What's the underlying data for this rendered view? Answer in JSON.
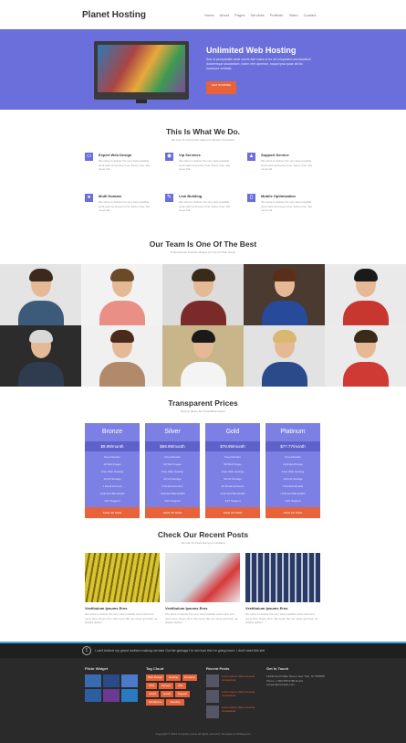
{
  "header": {
    "logo": "Planet Hosting",
    "nav": [
      "Home",
      "About",
      "Pages",
      "Services",
      "Portfolio",
      "Video",
      "Contact"
    ]
  },
  "hero": {
    "title": "Unlimited Web Hosting",
    "description": "Sed ut perspiciatis unde omnis iste natus error sit voluptatem accusantium doloremque laudantium, totam rem aperiam, eaque ipsa quae ab illo inventore veritatis.",
    "button": "GET STARTED"
  },
  "services": {
    "title": "This Is What We Do.",
    "subtitle": "We Like To Invent New Ideas For Modern Templates",
    "items": [
      {
        "title": "Expert Web Design",
        "icon": "monitor-icon",
        "desc": "We strive to deliver the very best possible work each and every time. Every time. We never fail."
      },
      {
        "title": "Vip Services",
        "icon": "car-icon",
        "desc": "We strive to deliver the very best possible work each and every time. Every time. We never fail."
      },
      {
        "title": "Support Service",
        "icon": "chart-icon",
        "desc": "We strive to deliver the very best possible work each and every time. Every time. We never fail."
      },
      {
        "title": "Multi Domain",
        "icon": "globe-icon",
        "desc": "We strive to deliver the very best possible work each and every time. Every time. We never fail."
      },
      {
        "title": "Link Building",
        "icon": "pencil-icon",
        "desc": "We strive to deliver the very best possible work each and every time. Every time. We never fail."
      },
      {
        "title": "Mobile Optimization",
        "icon": "tablet-icon",
        "desc": "We strive to deliver the very best possible work each and every time. Every time. We never fail."
      }
    ]
  },
  "team": {
    "title": "Our Team Is One Of The Best",
    "subtitle": "Professionals That Are Always On Top Of Their Game"
  },
  "pricing": {
    "title": "Transparent Prices",
    "subtitle": "Pricing Tables For Small Businesses",
    "plans": [
      {
        "name": "Bronze",
        "price": "$9.99/month",
        "features": [
          "Free Domain",
          "10 Web Pages",
          "Free Web Hosting",
          "10 Gb Storage",
          "1 Email Account",
          "Unlimited Bandwidth",
          "24/7 Support"
        ],
        "button": "SIGN UP NOW"
      },
      {
        "name": "Silver",
        "price": "$69.99/month",
        "features": [
          "Free Domain",
          "20 Web Pages",
          "Free Web Hosting",
          "20 Gb Storage",
          "5 Email Accounts",
          "Unlimited Bandwidth",
          "24/7 Support"
        ],
        "button": "SIGN UP NOW"
      },
      {
        "name": "Gold",
        "price": "$79.99/month",
        "features": [
          "Free Domain",
          "50 Web Pages",
          "Free Web Hosting",
          "50 Gb Storage",
          "10 Email Accounts",
          "Unlimited Bandwidth",
          "24/7 Support"
        ],
        "button": "SIGN UP NOW"
      },
      {
        "name": "Platinum",
        "price": "$77.77/month",
        "features": [
          "Free Domain",
          "Unlimited Pages",
          "Free Web Hosting",
          "100 Gb Storage",
          "Unlimited Emails",
          "Unlimited Bandwidth",
          "24/7 Support"
        ],
        "button": "SIGN UP NOW"
      }
    ]
  },
  "posts": {
    "title": "Check Our Recent Posts",
    "subtitle": "We Like To Keep Everyone Updated",
    "items": [
      {
        "title": "Vestibulum Ipsums Eros",
        "desc": "We strive to deliver the very best possible work each and every time. Every time. We never fail, we never get tired, we always deliver."
      },
      {
        "title": "Vestibulum Ipsums Eros",
        "desc": "We strive to deliver the very best possible work each and every time. Every time. We never fail, we never get tired, we always deliver."
      },
      {
        "title": "Vestibulum Ipsums Eros",
        "desc": "We strive to deliver the very best possible work each and every time. Every time. We never fail, we never get tired, we always deliver."
      }
    ]
  },
  "twitter": {
    "text": "I can't believe my grand mothers making me take Out the garbage I'm rich fuck this I'm going home. I don't need this shit"
  },
  "footer": {
    "flickr_title": "Flickr Widget",
    "tags_title": "Tag Cloud",
    "tags": [
      "Web Design",
      "Hosting",
      "Domains",
      "VPS",
      "Servers",
      "SSL",
      "Cloud",
      "Email",
      "Support",
      "Wordpress",
      "Security"
    ],
    "recent_title": "Recent Posts",
    "recent": [
      "Lorem ipsum dolor sit amet consectetur",
      "Lorem ipsum dolor sit amet consectetur",
      "Lorem ipsum dolor sit amet consectetur"
    ],
    "contact_title": "Get In Touch",
    "contact": "12345 North Main Street, New York, NY 555555. Phone: 1.800.555.6789 Email: support@example.com",
    "copyright": "Copyright © 2014 Company name All rights reserved. Template by W3Layouts"
  },
  "colors": {
    "accent": "#6b6fdb",
    "orange": "#e8633a",
    "footer": "#2a2a2a"
  }
}
